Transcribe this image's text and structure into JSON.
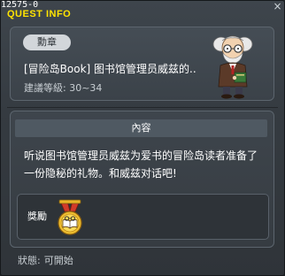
{
  "window": {
    "quest_id": "12575-0",
    "title": "QUEST INFO",
    "close_glyph": "×"
  },
  "header": {
    "tag": "勳章",
    "quest_title": "[冒险岛Book] 图书馆管理员威兹的..",
    "level_label": "建議等級",
    "level_range": "30~34",
    "npc_icon": "librarian-wizet-npc-icon"
  },
  "content": {
    "section_title": "內容",
    "description_line1": "听说图书馆管理员威兹为爱书的冒险岛读者准备了",
    "description_line2": "一份隐秘的礼物。和威兹对话吧!",
    "reward_label": "獎勵",
    "reward_icon": "medal-icon"
  },
  "status": {
    "label": "狀態:",
    "value": "可開始"
  },
  "colors": {
    "title": "#ffe400",
    "text": "#ffffff",
    "panel_border": "#5c656e",
    "section_bar": "#4f5962"
  }
}
